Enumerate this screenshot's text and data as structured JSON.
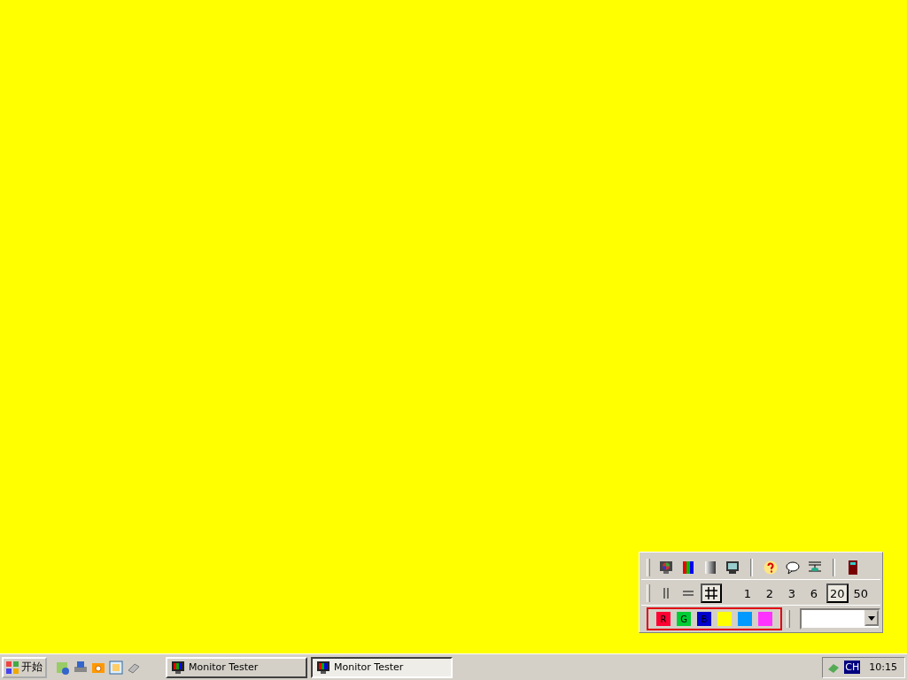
{
  "toolbar": {
    "line_modes": [
      {
        "kind": "vertical",
        "selected": false
      },
      {
        "kind": "horizontal",
        "selected": false
      },
      {
        "kind": "grid",
        "selected": true
      }
    ],
    "spacings": [
      {
        "label": "1",
        "selected": false
      },
      {
        "label": "2",
        "selected": false
      },
      {
        "label": "3",
        "selected": false
      },
      {
        "label": "6",
        "selected": false
      },
      {
        "label": "20",
        "selected": true
      },
      {
        "label": "50",
        "selected": false
      }
    ],
    "colors": [
      {
        "label": "R",
        "color": "#ff0033"
      },
      {
        "label": "G",
        "color": "#00cc33"
      },
      {
        "label": "B",
        "color": "#0000cc"
      },
      {
        "color": "#ffff00"
      },
      {
        "color": "#0099ff"
      },
      {
        "color": "#ff33ff"
      }
    ]
  },
  "taskbar": {
    "start": "开始",
    "tasks": [
      {
        "label": "Monitor Tester",
        "selected": false
      },
      {
        "label": "Monitor Tester",
        "selected": true
      }
    ],
    "language": "CH",
    "clock": "10:15"
  }
}
